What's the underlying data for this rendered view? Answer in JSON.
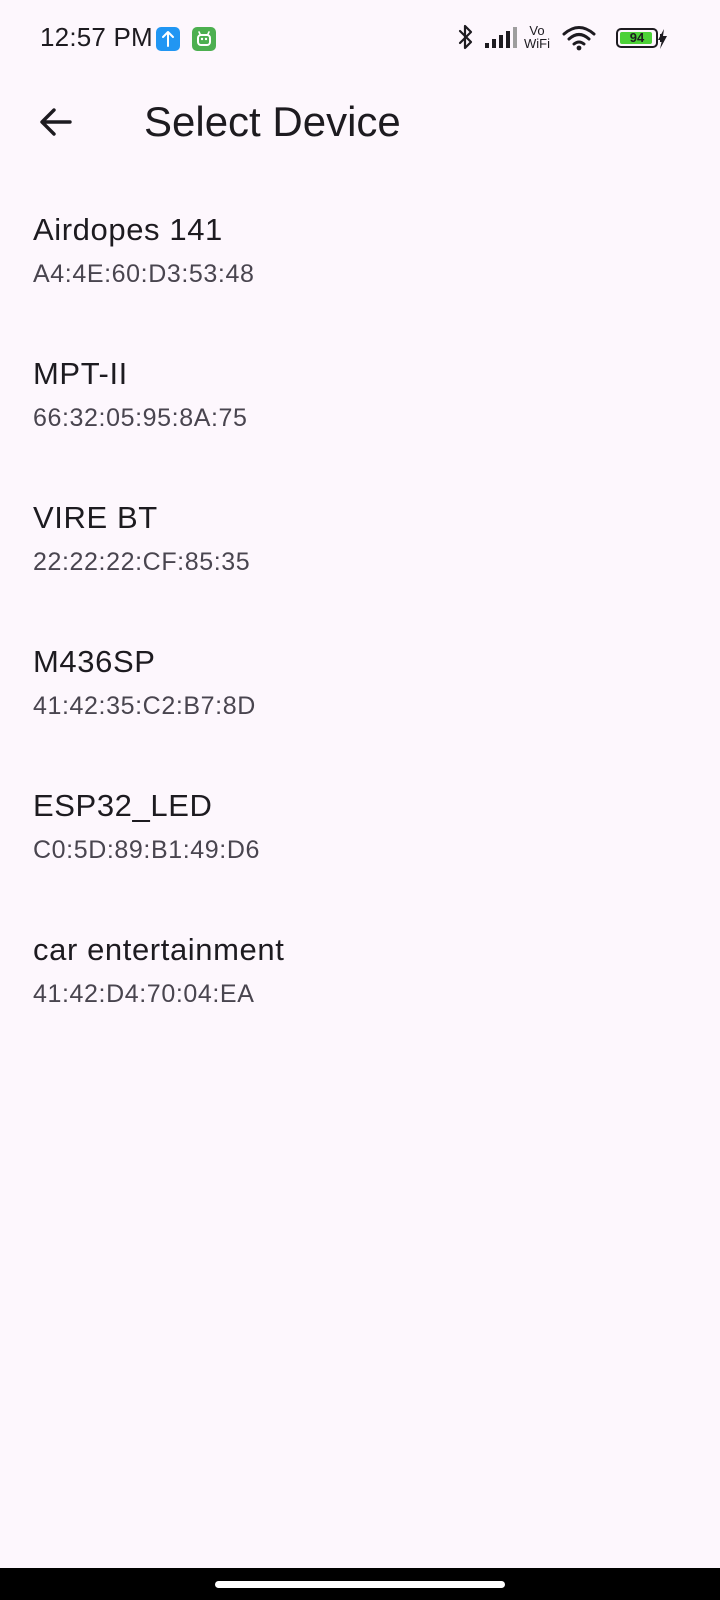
{
  "status_bar": {
    "time": "12:57 PM",
    "notification_icons": [
      "upload-icon",
      "android-icon"
    ],
    "system_icons": [
      "bluetooth-icon",
      "signal-icon",
      "vowifi-icon",
      "wifi-icon",
      "battery-icon",
      "charging-icon"
    ],
    "vowifi_top": "Vo",
    "vowifi_bottom": "WiFi",
    "battery_level": "94",
    "battery_fraction": 0.94
  },
  "app_bar": {
    "back_icon": "arrow-back-icon",
    "title": "Select Device"
  },
  "devices": [
    {
      "name": "Airdopes 141",
      "address": "A4:4E:60:D3:53:48"
    },
    {
      "name": "MPT-II",
      "address": "66:32:05:95:8A:75"
    },
    {
      "name": "VIRE BT",
      "address": "22:22:22:CF:85:35"
    },
    {
      "name": "M436SP",
      "address": "41:42:35:C2:B7:8D"
    },
    {
      "name": "ESP32_LED",
      "address": "C0:5D:89:B1:49:D6"
    },
    {
      "name": "car entertainment",
      "address": "41:42:D4:70:04:EA"
    }
  ],
  "colors": {
    "background": "#FDF7FD",
    "text_primary": "#1D1B20",
    "text_secondary": "#49454F",
    "battery_fill": "#4CD137",
    "nav_bar": "#000000"
  }
}
